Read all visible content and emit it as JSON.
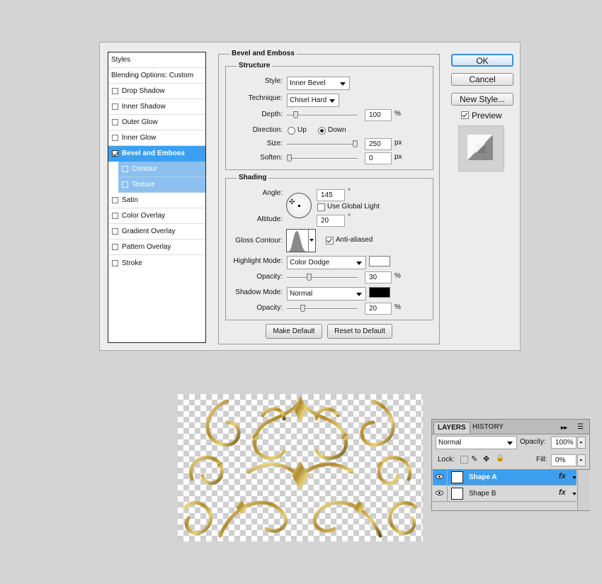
{
  "styles_panel": {
    "header": "Styles",
    "blending": "Blending Options: Custom",
    "items": [
      {
        "label": "Drop Shadow",
        "checked": false
      },
      {
        "label": "Inner Shadow",
        "checked": false
      },
      {
        "label": "Outer Glow",
        "checked": false
      },
      {
        "label": "Inner Glow",
        "checked": false
      },
      {
        "label": "Bevel and Emboss",
        "checked": true
      },
      {
        "label": "Contour",
        "checked": false
      },
      {
        "label": "Texture",
        "checked": false
      },
      {
        "label": "Satin",
        "checked": false
      },
      {
        "label": "Color Overlay",
        "checked": false
      },
      {
        "label": "Gradient Overlay",
        "checked": false
      },
      {
        "label": "Pattern Overlay",
        "checked": false
      },
      {
        "label": "Stroke",
        "checked": false
      }
    ]
  },
  "bevel": {
    "title": "Bevel and Emboss",
    "structure": {
      "legend": "Structure",
      "style_label": "Style:",
      "style_value": "Inner Bevel",
      "technique_label": "Technique:",
      "technique_value": "Chisel Hard",
      "depth_label": "Depth:",
      "depth_value": "100",
      "depth_unit": "%",
      "depth_slider": 0.1,
      "direction_label": "Direction:",
      "dir_up": "Up",
      "dir_down": "Down",
      "direction_selected": "Down",
      "size_label": "Size:",
      "size_value": "250",
      "size_unit": "px",
      "size_slider": 1.0,
      "soften_label": "Soften:",
      "soften_value": "0",
      "soften_unit": "px",
      "soften_slider": 0.0
    },
    "shading": {
      "legend": "Shading",
      "angle_label": "Angle:",
      "angle_value": "145",
      "angle_unit": "°",
      "use_global_light": "Use Global Light",
      "use_global_light_checked": false,
      "altitude_label": "Altitude:",
      "altitude_value": "20",
      "altitude_unit": "°",
      "gloss_label": "Gloss Contour:",
      "anti_aliased": "Anti-aliased",
      "anti_aliased_checked": true,
      "highlight_label": "Highlight Mode:",
      "highlight_value": "Color Dodge",
      "highlight_color": "#ffffff",
      "hopacity_label": "Opacity:",
      "hopacity_value": "30",
      "hopacity_unit": "%",
      "hopacity_slider": 0.3,
      "shadow_label": "Shadow Mode:",
      "shadow_value": "Normal",
      "shadow_color": "#000000",
      "sopacity_label": "Opacity:",
      "sopacity_value": "20",
      "sopacity_unit": "%",
      "sopacity_slider": 0.2
    },
    "make_default": "Make Default",
    "reset_default": "Reset to Default"
  },
  "actions": {
    "ok": "OK",
    "cancel": "Cancel",
    "new_style": "New Style...",
    "preview": "Preview",
    "preview_checked": true
  },
  "layers_panel": {
    "tab_layers": "LAYERS",
    "tab_history": "HISTORY",
    "blend_mode": "Normal",
    "opacity_label": "Opacity:",
    "opacity_value": "100%",
    "lock_label": "Lock:",
    "fill_label": "Fill:",
    "fill_value": "0%",
    "layers": [
      {
        "name": "Shape A",
        "fx": "fx",
        "selected": true
      },
      {
        "name": "Shape B",
        "fx": "fx",
        "selected": false
      }
    ]
  },
  "colors": {
    "selection": "#3d9ff0",
    "sub_selection": "#8dc0ee",
    "dialog_bg": "#ececec",
    "gold": "#b89a3c"
  }
}
